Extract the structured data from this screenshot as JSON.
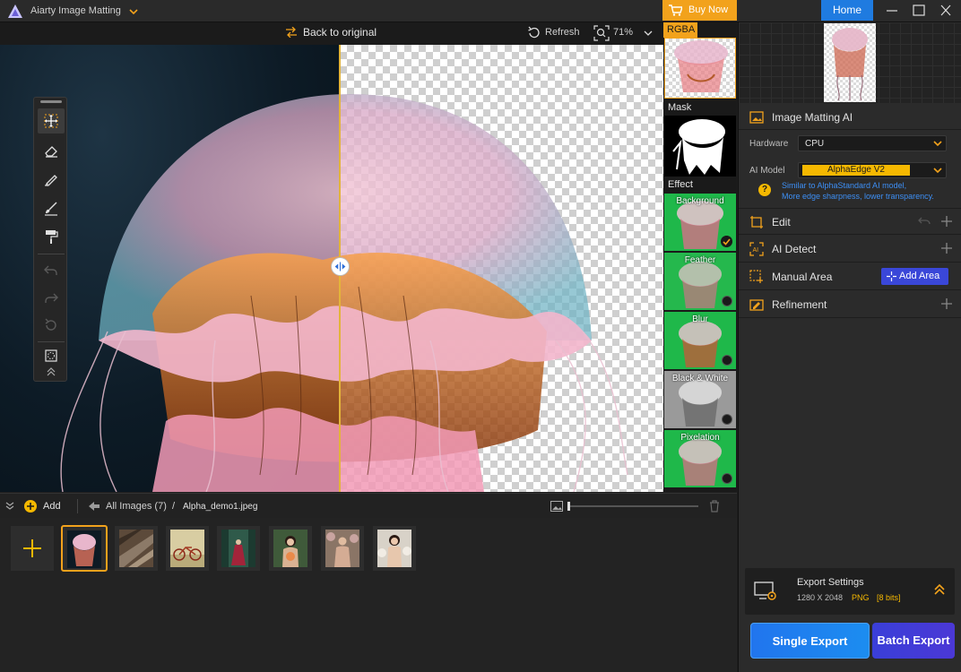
{
  "app": {
    "title": "Aiarty Image Matting",
    "buy_now": "Buy Now",
    "home": "Home"
  },
  "viewer": {
    "back_to_original": "Back to original",
    "refresh": "Refresh",
    "zoom": "71%"
  },
  "strip": {
    "rgba": "RGBA",
    "mask": "Mask",
    "effect": "Effect",
    "effects": [
      {
        "label": "Background",
        "selected": true
      },
      {
        "label": "Feather",
        "selected": false
      },
      {
        "label": "Blur",
        "selected": false
      },
      {
        "label": "Black & White",
        "selected": false
      },
      {
        "label": "Pixelation",
        "selected": false
      }
    ]
  },
  "panel": {
    "matting_title": "Image Matting AI",
    "hardware_label": "Hardware",
    "hardware_value": "CPU",
    "model_label": "AI Model",
    "model_value": "AlphaEdge  V2",
    "hint_line1": "Similar to AlphaStandard AI model,",
    "hint_line2": "More edge sharpness, lower transparency.",
    "sections": {
      "edit": "Edit",
      "ai_detect": "AI Detect",
      "manual_area": "Manual Area",
      "refinement": "Refinement"
    },
    "add_area": "Add Area",
    "export": {
      "title": "Export Settings",
      "dims": "1280 X 2048",
      "format": "PNG",
      "bits": "[8 bits]"
    },
    "single_export": "Single Export",
    "batch_export": "Batch Export"
  },
  "bottom": {
    "add": "Add",
    "all_images": "All Images (7)",
    "slash": "/",
    "filename": "Alpha_demo1.jpeg",
    "thumb_zoom": 0.0
  },
  "colors": {
    "accent": "#f2a21c",
    "primary": "#1f7be0",
    "hint": "#3d8ff5",
    "model_highlight": "#f5b800",
    "effect_green": "#1fb84a"
  }
}
